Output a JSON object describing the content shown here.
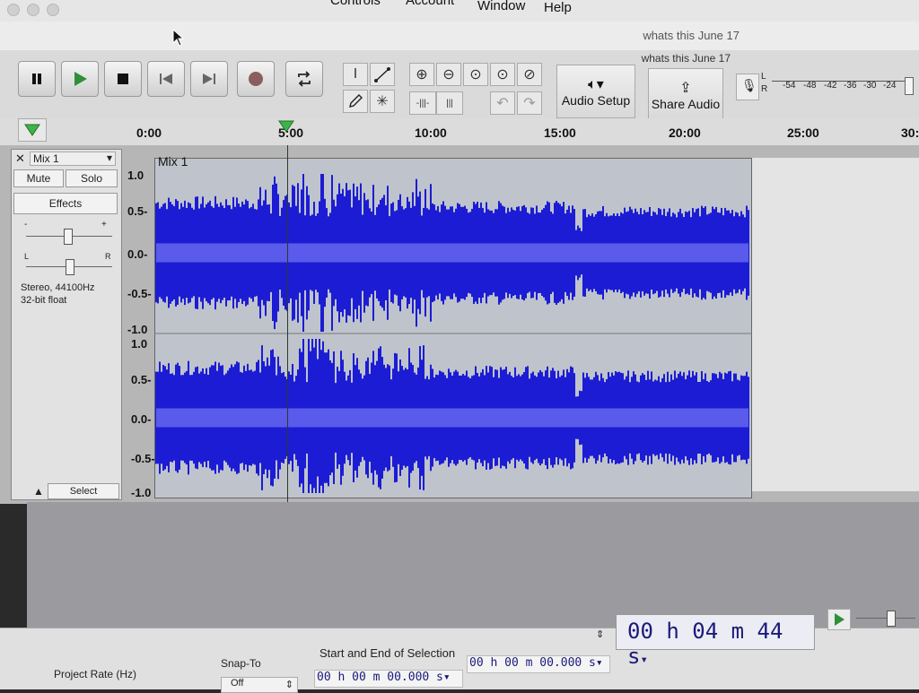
{
  "menubar": {
    "items": [
      {
        "label": "Controls"
      },
      {
        "label": "Account"
      },
      {
        "label": "Window"
      },
      {
        "label": "Help"
      }
    ]
  },
  "window": {
    "title": "whats this June 17",
    "project_name": "whats this June 17"
  },
  "toolbar": {
    "audio_setup_label": "Audio Setup",
    "share_audio_label": "Share Audio",
    "meter_channels": [
      "L",
      "R"
    ],
    "meter_ticks": [
      "-54",
      "-48",
      "-42",
      "-36",
      "-30",
      "-24"
    ]
  },
  "timeline": {
    "labels": [
      "0:00",
      "5:00",
      "10:00",
      "15:00",
      "20:00",
      "25:00",
      "30:"
    ]
  },
  "track": {
    "name": "Mix 1",
    "mute_label": "Mute",
    "solo_label": "Solo",
    "effects_label": "Effects",
    "gain_minus": "-",
    "gain_plus": "+",
    "pan_left": "L",
    "pan_right": "R",
    "format_line1": "Stereo, 44100Hz",
    "format_line2": "32-bit float",
    "select_label": "Select",
    "clip_name": "Mix 1",
    "scale_top": [
      "1.0",
      "0.5-",
      "0.0-",
      "-0.5-",
      "-1.0"
    ],
    "scale_bottom": [
      "1.0",
      "0.5-",
      "0.0-",
      "-0.5-",
      "-1.0"
    ]
  },
  "selection_toolbar": {
    "project_rate_label": "Project Rate (Hz)",
    "snap_to_label": "Snap-To",
    "snap_to_value": "Off",
    "selection_label": "Start and End of Selection",
    "selection_start": "00 h 00 m 00.000 s",
    "selection_end": "00 h 00 m 00.000 s",
    "position": "00 h 04 m 44 s"
  },
  "colors": {
    "waveform": "#1c1cd4",
    "waveform_rms": "#6a6af0",
    "clip_background": "#bfc4cc",
    "play_green": "#2f8f3a"
  }
}
